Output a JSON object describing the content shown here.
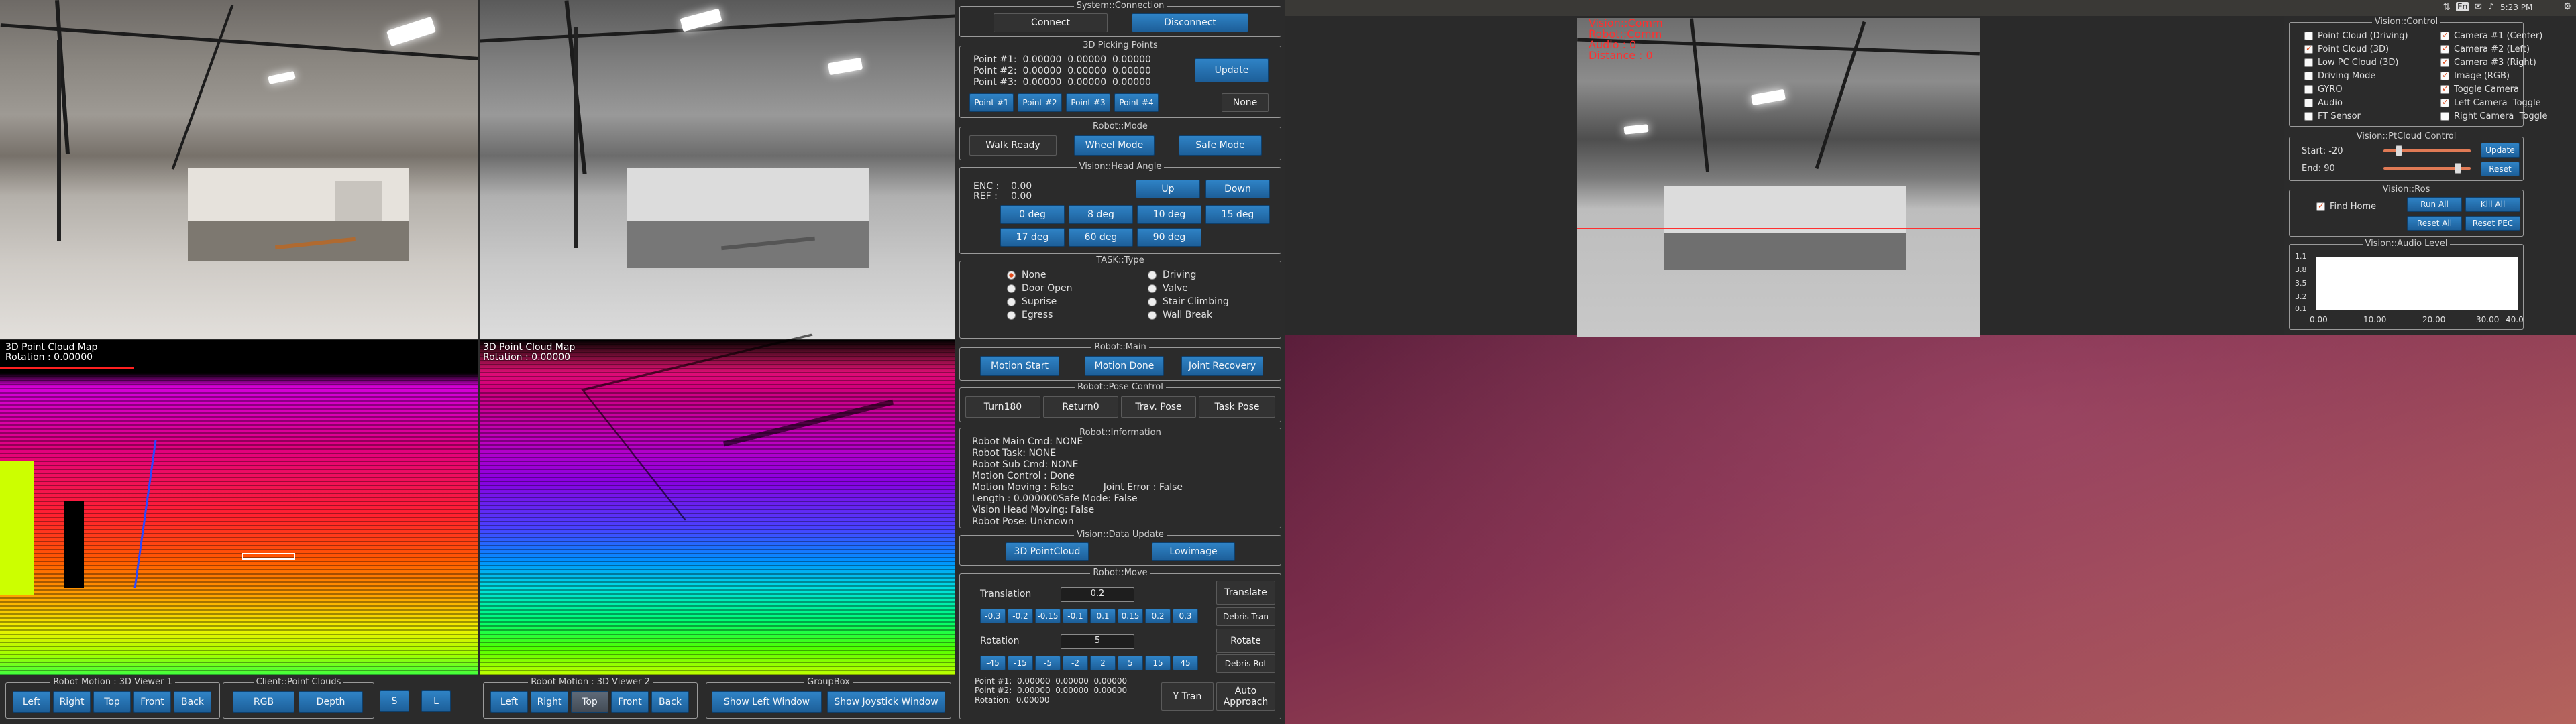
{
  "viewers": {
    "cloud_label": "3D Point Cloud Map",
    "rotation_left": "Rotation : 0.00000",
    "rotation_right": "Rotation : 0.00000"
  },
  "bottom_bar": {
    "viewer1_title": "Robot Motion : 3D Viewer 1",
    "viewer1_buttons": [
      "Left",
      "Right",
      "Top",
      "Front",
      "Back"
    ],
    "clouds_title": "Client::Point Clouds",
    "clouds_buttons": [
      "RGB",
      "Depth",
      "S",
      "L"
    ],
    "viewer2_title": "Robot Motion : 3D Viewer 2",
    "viewer2_buttons": [
      "Left",
      "Right",
      "Top",
      "Front",
      "Back"
    ],
    "groupbox_title": "GroupBox",
    "groupbox_buttons": [
      "Show Left Window",
      "Show Joystick Window"
    ]
  },
  "connection": {
    "title": "System::Connection",
    "connect": "Connect",
    "disconnect": "Disconnect"
  },
  "picking": {
    "title": "3D Picking Points",
    "points": [
      "Point #1:  0.00000  0.00000  0.00000",
      "Point #2:  0.00000  0.00000  0.00000",
      "Point #3:  0.00000  0.00000  0.00000"
    ],
    "update": "Update",
    "point_buttons": [
      "Point #1",
      "Point #2",
      "Point #3",
      "Point #4"
    ],
    "none": "None"
  },
  "robot_mode": {
    "title": "Robot::Mode",
    "buttons": [
      "Walk Ready",
      "Wheel Mode",
      "Safe Mode"
    ]
  },
  "head_angle": {
    "title": "Vision::Head Angle",
    "enc_label": "ENC :",
    "enc_value": "0.00",
    "ref_label": "REF :",
    "ref_value": "0.00",
    "up": "Up",
    "down": "Down",
    "angles_row1": [
      "0 deg",
      "8 deg",
      "10 deg",
      "15 deg"
    ],
    "angles_row2": [
      "17 deg",
      "60 deg",
      "90 deg"
    ]
  },
  "task_type": {
    "title": "TASK::Type",
    "left": [
      "None",
      "Door Open",
      "Suprise",
      "Egress"
    ],
    "right": [
      "Driving",
      "Valve",
      "Stair Climbing",
      "Wall Break"
    ],
    "selected": "None"
  },
  "robot_main": {
    "title": "Robot::Main",
    "buttons": [
      "Motion Start",
      "Motion Done",
      "Joint Recovery"
    ]
  },
  "pose_control": {
    "title": "Robot::Pose Control",
    "buttons": [
      "Turn180",
      "Return0",
      "Trav. Pose",
      "Task Pose"
    ]
  },
  "information": {
    "title": "Robot::Information",
    "lines": [
      "Robot Main Cmd: NONE",
      "Robot Task: NONE",
      "Robot Sub Cmd: NONE",
      "Motion Control : Done",
      "Motion Moving : False          Joint Error : False",
      "Length : 0.000000Safe Mode: False",
      "Vision Head Moving: False",
      "Robot Pose: Unknown"
    ]
  },
  "data_update": {
    "title": "Vision::Data Update",
    "buttons": [
      "3D PointCloud",
      "Lowimage"
    ]
  },
  "move": {
    "title": "Robot::Move",
    "translation_label": "Translation",
    "translation_value": "0.2",
    "translation_steps": [
      "-0.3",
      "-0.2",
      "-0.15",
      "-0.1",
      "0.1",
      "0.15",
      "0.2",
      "0.3"
    ],
    "translate": "Translate",
    "debris_tran": "Debris Tran",
    "rotation_label": "Rotation",
    "rotation_value": "5",
    "rotation_steps": [
      "-45",
      "-15",
      "-5",
      "-2",
      "2",
      "5",
      "15",
      "45"
    ],
    "rotate": "Rotate",
    "debris_rot": "Debris Rot",
    "readout": [
      "Point #1:  0.00000  0.00000  0.00000",
      "Point #2:  0.00000  0.00000  0.00000",
      "Rotation:  0.00000"
    ],
    "y_tran": "Y Tran",
    "auto_approach": "Auto\nApproach"
  },
  "vision_hud": {
    "lines_left": [
      "Vision::Comm",
      "Robot::Comm",
      "Audio : 0",
      "Distance : 0"
    ],
    "lines_right": [
      "",
      ""
    ]
  },
  "vision_control": {
    "title": "Vision::Control",
    "left": [
      {
        "label": "Point Cloud (Driving)",
        "checked": false
      },
      {
        "label": "Point Cloud (3D)",
        "checked": true
      },
      {
        "label": "Low PC Cloud (3D)",
        "checked": false
      },
      {
        "label": "Driving Mode",
        "checked": false
      },
      {
        "label": "GYRO",
        "checked": false
      },
      {
        "label": "Audio",
        "checked": false
      },
      {
        "label": "FT Sensor",
        "checked": false
      }
    ],
    "right": [
      {
        "label": "Camera #1 (Center)",
        "checked": true
      },
      {
        "label": "Camera #2 (Left)",
        "checked": true
      },
      {
        "label": "Camera #3 (Right)",
        "checked": true
      },
      {
        "label": "Image (RGB)",
        "checked": true
      },
      {
        "label": "Toggle Camera",
        "checked": true
      },
      {
        "label": "Left Camera  Toggle",
        "checked": true
      },
      {
        "label": "Right Camera  Toggle",
        "checked": false
      }
    ]
  },
  "ptcloud_control": {
    "title": "Vision::PtCloud Control",
    "start_label": "Start: -20",
    "end_label": "End: 90",
    "start_value": 0.18,
    "end_value": 0.85,
    "update": "Update",
    "reset": "Reset"
  },
  "ros": {
    "title": "Vision::Ros",
    "find_home": "Find Home",
    "find_home_checked": true,
    "buttons": [
      "Run All",
      "Kill All",
      "Reset All",
      "Reset PEC"
    ]
  },
  "audio_level": {
    "title": "Vision::Audio Level",
    "y_ticks": [
      "1.1",
      "3.8",
      "3.5",
      "3.2",
      "0.1"
    ],
    "x_ticks": [
      "0.00",
      "10.00",
      "20.00",
      "30.00",
      "40.0"
    ]
  },
  "topbar": {
    "lang": "En",
    "time": "5:23 PM"
  }
}
